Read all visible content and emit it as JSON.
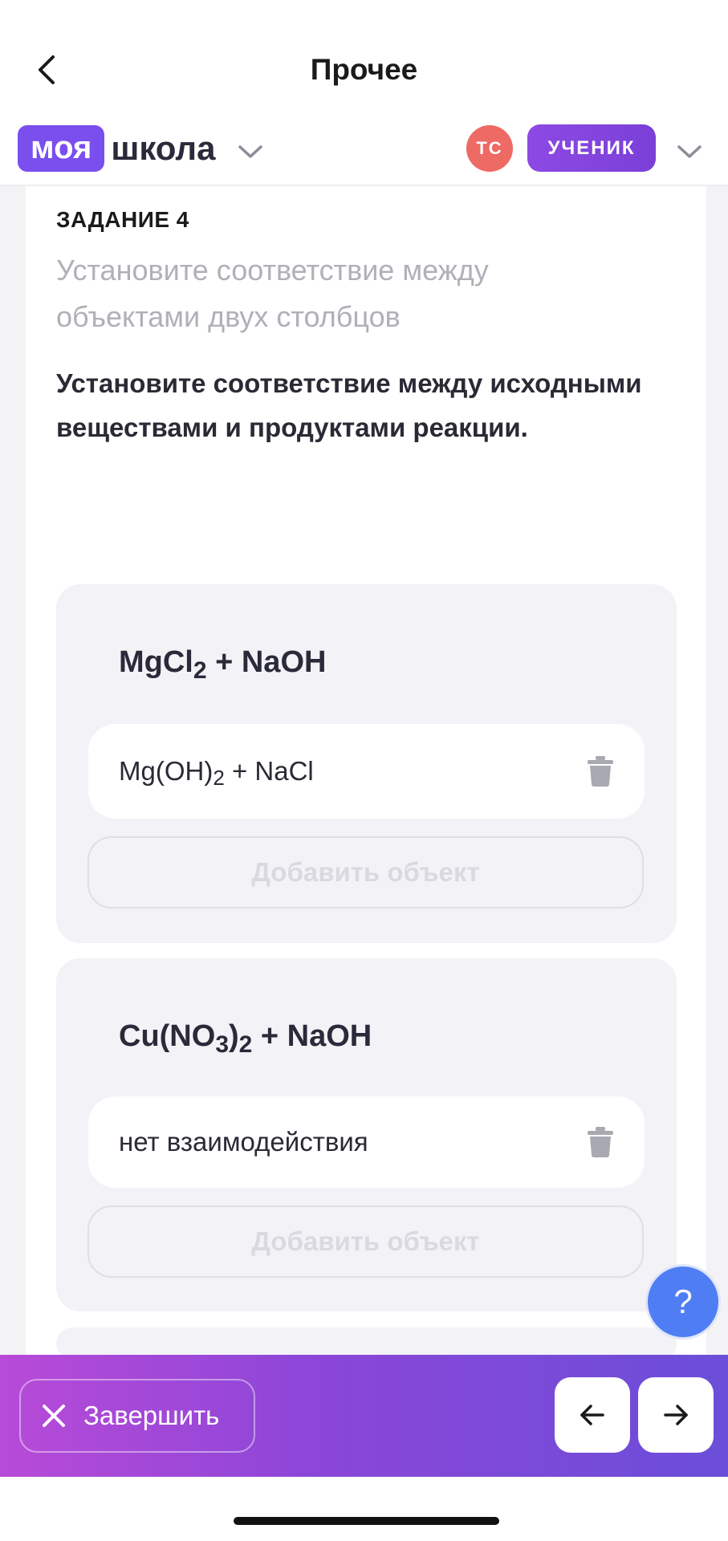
{
  "header": {
    "title": "Прочее"
  },
  "brand": {
    "part1": "моя",
    "part2": "школа"
  },
  "user": {
    "initials": "ТС",
    "role": "УЧЕНИК"
  },
  "task": {
    "label": "ЗАДАНИЕ 4",
    "hint": "Установите соответствие между объектами двух столбцов",
    "question": "Установите соответствие между исходными веществами и продуктами реакции."
  },
  "groups": [
    {
      "title": {
        "a": "MgCl",
        "a_sub": "2",
        "b": " + NaOH"
      },
      "answer": {
        "a": "Mg(OH)",
        "a_sub": "2",
        "b": " + NaCl"
      },
      "add_label": "Добавить объект"
    },
    {
      "title": {
        "a": "Cu(NO",
        "a_sub": "3",
        "b": ")",
        "b_sub": "2",
        "c": " + NaOH"
      },
      "answer": {
        "text": "нет взаимодействия"
      },
      "add_label": "Добавить объект"
    }
  ],
  "help": {
    "label": "?"
  },
  "footer": {
    "finish_label": "Завершить"
  },
  "icons": {
    "back": "chevron-left-icon",
    "brand_dropdown": "chevron-down-icon",
    "user_dropdown": "chevron-down-icon",
    "delete": "trash-icon",
    "finish": "close-icon",
    "prev": "arrow-left-icon",
    "next": "arrow-right-icon"
  },
  "colors": {
    "brand": "#7a4fee",
    "avatar": "#ee6a64",
    "role_badge": "#8a46e0",
    "help": "#4f7df3",
    "footer_gradient_start": "#b84ad8",
    "footer_gradient_end": "#6b4ed8"
  }
}
